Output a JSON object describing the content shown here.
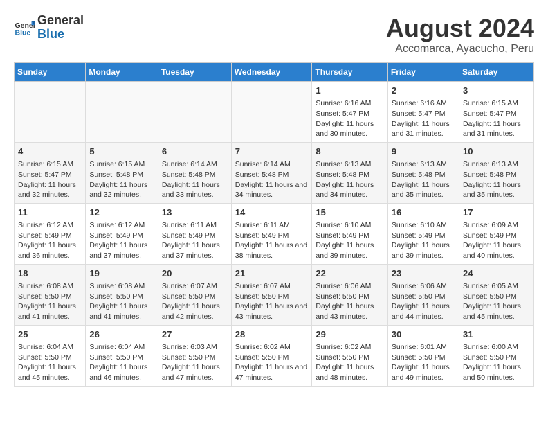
{
  "header": {
    "logo_line1": "General",
    "logo_line2": "Blue",
    "title": "August 2024",
    "subtitle": "Accomarca, Ayacucho, Peru"
  },
  "columns": [
    "Sunday",
    "Monday",
    "Tuesday",
    "Wednesday",
    "Thursday",
    "Friday",
    "Saturday"
  ],
  "weeks": [
    [
      {
        "day": "",
        "info": ""
      },
      {
        "day": "",
        "info": ""
      },
      {
        "day": "",
        "info": ""
      },
      {
        "day": "",
        "info": ""
      },
      {
        "day": "1",
        "info": "Sunrise: 6:16 AM\nSunset: 5:47 PM\nDaylight: 11 hours and 30 minutes."
      },
      {
        "day": "2",
        "info": "Sunrise: 6:16 AM\nSunset: 5:47 PM\nDaylight: 11 hours and 31 minutes."
      },
      {
        "day": "3",
        "info": "Sunrise: 6:15 AM\nSunset: 5:47 PM\nDaylight: 11 hours and 31 minutes."
      }
    ],
    [
      {
        "day": "4",
        "info": "Sunrise: 6:15 AM\nSunset: 5:47 PM\nDaylight: 11 hours and 32 minutes."
      },
      {
        "day": "5",
        "info": "Sunrise: 6:15 AM\nSunset: 5:48 PM\nDaylight: 11 hours and 32 minutes."
      },
      {
        "day": "6",
        "info": "Sunrise: 6:14 AM\nSunset: 5:48 PM\nDaylight: 11 hours and 33 minutes."
      },
      {
        "day": "7",
        "info": "Sunrise: 6:14 AM\nSunset: 5:48 PM\nDaylight: 11 hours and 34 minutes."
      },
      {
        "day": "8",
        "info": "Sunrise: 6:13 AM\nSunset: 5:48 PM\nDaylight: 11 hours and 34 minutes."
      },
      {
        "day": "9",
        "info": "Sunrise: 6:13 AM\nSunset: 5:48 PM\nDaylight: 11 hours and 35 minutes."
      },
      {
        "day": "10",
        "info": "Sunrise: 6:13 AM\nSunset: 5:48 PM\nDaylight: 11 hours and 35 minutes."
      }
    ],
    [
      {
        "day": "11",
        "info": "Sunrise: 6:12 AM\nSunset: 5:49 PM\nDaylight: 11 hours and 36 minutes."
      },
      {
        "day": "12",
        "info": "Sunrise: 6:12 AM\nSunset: 5:49 PM\nDaylight: 11 hours and 37 minutes."
      },
      {
        "day": "13",
        "info": "Sunrise: 6:11 AM\nSunset: 5:49 PM\nDaylight: 11 hours and 37 minutes."
      },
      {
        "day": "14",
        "info": "Sunrise: 6:11 AM\nSunset: 5:49 PM\nDaylight: 11 hours and 38 minutes."
      },
      {
        "day": "15",
        "info": "Sunrise: 6:10 AM\nSunset: 5:49 PM\nDaylight: 11 hours and 39 minutes."
      },
      {
        "day": "16",
        "info": "Sunrise: 6:10 AM\nSunset: 5:49 PM\nDaylight: 11 hours and 39 minutes."
      },
      {
        "day": "17",
        "info": "Sunrise: 6:09 AM\nSunset: 5:49 PM\nDaylight: 11 hours and 40 minutes."
      }
    ],
    [
      {
        "day": "18",
        "info": "Sunrise: 6:08 AM\nSunset: 5:50 PM\nDaylight: 11 hours and 41 minutes."
      },
      {
        "day": "19",
        "info": "Sunrise: 6:08 AM\nSunset: 5:50 PM\nDaylight: 11 hours and 41 minutes."
      },
      {
        "day": "20",
        "info": "Sunrise: 6:07 AM\nSunset: 5:50 PM\nDaylight: 11 hours and 42 minutes."
      },
      {
        "day": "21",
        "info": "Sunrise: 6:07 AM\nSunset: 5:50 PM\nDaylight: 11 hours and 43 minutes."
      },
      {
        "day": "22",
        "info": "Sunrise: 6:06 AM\nSunset: 5:50 PM\nDaylight: 11 hours and 43 minutes."
      },
      {
        "day": "23",
        "info": "Sunrise: 6:06 AM\nSunset: 5:50 PM\nDaylight: 11 hours and 44 minutes."
      },
      {
        "day": "24",
        "info": "Sunrise: 6:05 AM\nSunset: 5:50 PM\nDaylight: 11 hours and 45 minutes."
      }
    ],
    [
      {
        "day": "25",
        "info": "Sunrise: 6:04 AM\nSunset: 5:50 PM\nDaylight: 11 hours and 45 minutes."
      },
      {
        "day": "26",
        "info": "Sunrise: 6:04 AM\nSunset: 5:50 PM\nDaylight: 11 hours and 46 minutes."
      },
      {
        "day": "27",
        "info": "Sunrise: 6:03 AM\nSunset: 5:50 PM\nDaylight: 11 hours and 47 minutes."
      },
      {
        "day": "28",
        "info": "Sunrise: 6:02 AM\nSunset: 5:50 PM\nDaylight: 11 hours and 47 minutes."
      },
      {
        "day": "29",
        "info": "Sunrise: 6:02 AM\nSunset: 5:50 PM\nDaylight: 11 hours and 48 minutes."
      },
      {
        "day": "30",
        "info": "Sunrise: 6:01 AM\nSunset: 5:50 PM\nDaylight: 11 hours and 49 minutes."
      },
      {
        "day": "31",
        "info": "Sunrise: 6:00 AM\nSunset: 5:50 PM\nDaylight: 11 hours and 50 minutes."
      }
    ]
  ]
}
